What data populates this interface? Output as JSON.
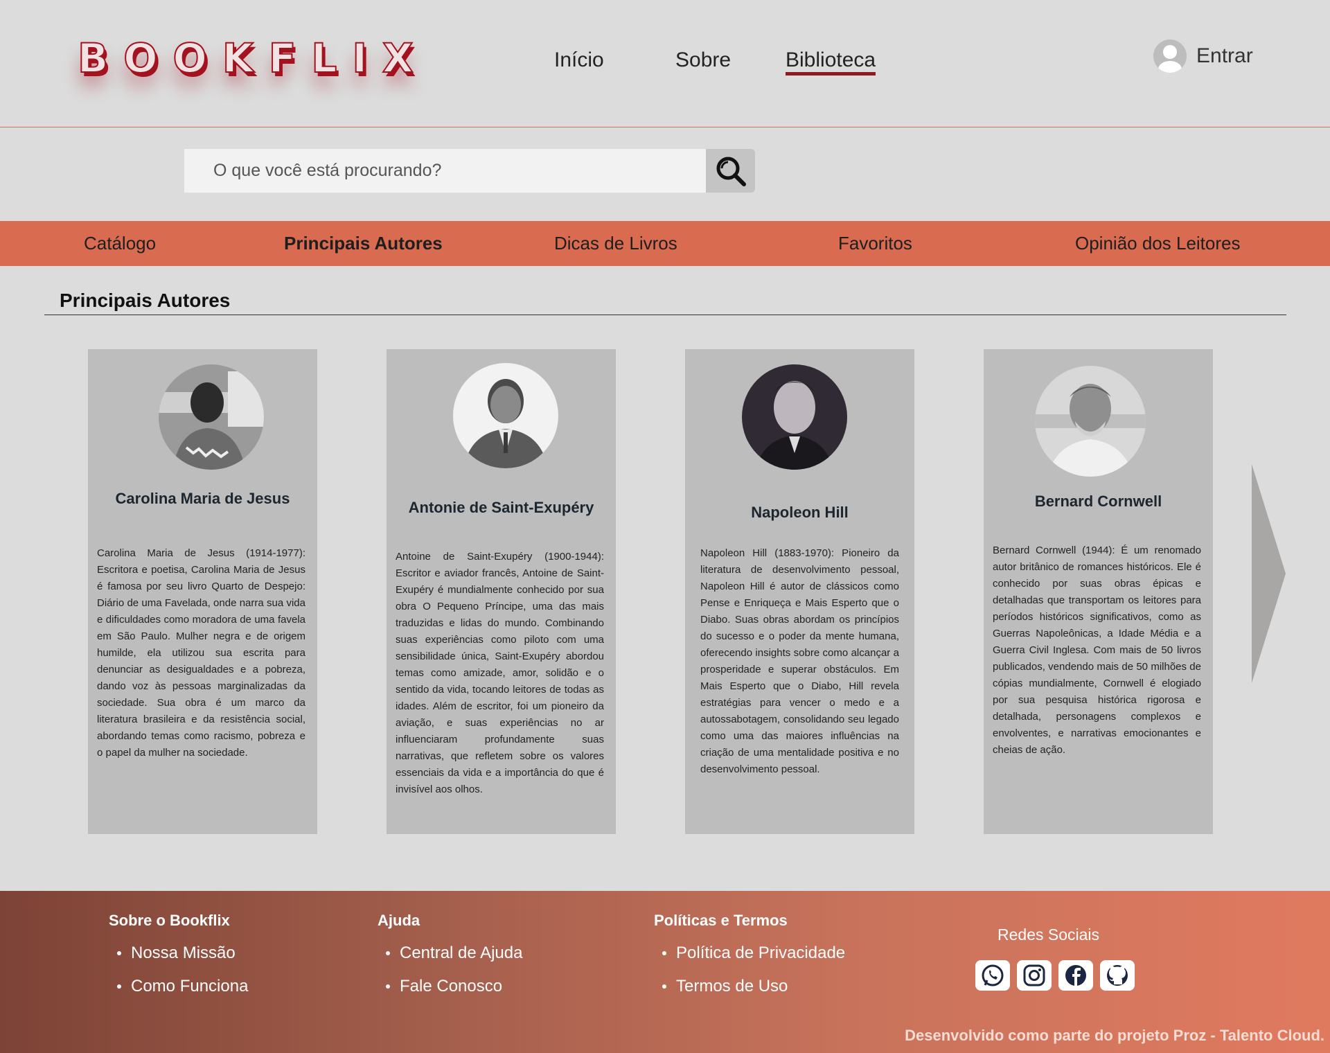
{
  "header": {
    "logo": "BOOKFLIX",
    "nav": [
      "Início",
      "Sobre",
      "Biblioteca"
    ],
    "active_nav": "Biblioteca",
    "login_label": "Entrar"
  },
  "search": {
    "placeholder": "O que você está procurando?"
  },
  "categories": [
    "Catálogo",
    "Principais Autores",
    "Dicas de Livros",
    "Favoritos",
    "Opinião dos Leitores"
  ],
  "active_category": "Principais Autores",
  "section": {
    "title": "Principais Autores"
  },
  "authors": [
    {
      "name": "Carolina Maria de Jesus",
      "bio": "Carolina Maria de Jesus (1914-1977): Escritora e poetisa, Carolina Maria de Jesus é famosa por seu livro Quarto de Despejo: Diário de uma Favelada, onde narra sua vida e dificuldades como moradora de uma favela em São Paulo. Mulher negra e de origem humilde, ela utilizou sua escrita para denunciar as desigualdades e a pobreza, dando voz às pessoas marginalizadas da sociedade. Sua obra é um marco da literatura brasileira e da resistência social, abordando temas como racismo, pobreza e o papel da mulher na sociedade."
    },
    {
      "name": "Antonie de Saint-Exupéry",
      "bio": "Antoine de Saint-Exupéry (1900-1944): Escritor e aviador francês, Antoine de Saint-Exupéry é mundialmente conhecido por sua obra O Pequeno Príncipe, uma das mais traduzidas e lidas do mundo. Combinando suas experiências como piloto com uma sensibilidade única, Saint-Exupéry abordou temas como amizade, amor, solidão e o sentido da vida, tocando leitores de todas as idades. Além de escritor, foi um pioneiro da aviação, e suas experiências no ar influenciaram profundamente suas narrativas, que refletem sobre os valores essenciais da vida e a importância do que é invisível aos olhos."
    },
    {
      "name": "Napoleon Hill",
      "bio": "Napoleon Hill (1883-1970): Pioneiro da literatura de desenvolvimento pessoal, Napoleon Hill é autor de clássicos como Pense e Enriqueça e Mais Esperto que o Diabo. Suas obras abordam os princípios do sucesso e o poder da mente humana, oferecendo insights sobre como alcançar a prosperidade e superar obstáculos. Em Mais Esperto que o Diabo, Hill revela estratégias para vencer o medo e a autossabotagem, consolidando seu legado como uma das maiores influências na criação de uma mentalidade positiva e no desenvolvimento pessoal."
    },
    {
      "name": "Bernard Cornwell",
      "bio": "Bernard Cornwell (1944): É um renomado autor britânico de romances históricos. Ele é conhecido por suas obras épicas e detalhadas que transportam os leitores para períodos históricos significativos, como as Guerras Napoleônicas, a Idade Média e a Guerra Civil Inglesa. Com mais de 50 livros publicados, vendendo mais de 50 milhões de cópias mundialmente, Cornwell é elogiado por sua pesquisa histórica rigorosa e detalhada, personagens complexos e envolventes, e narrativas emocionantes e cheias de ação."
    }
  ],
  "footer": {
    "columns": [
      {
        "title": "Sobre o Bookflix",
        "links": [
          "Nossa Missão",
          "Como Funciona"
        ]
      },
      {
        "title": "Ajuda",
        "links": [
          "Central de Ajuda",
          "Fale Conosco"
        ]
      },
      {
        "title": "Políticas e Termos",
        "links": [
          "Política de Privacidade",
          "Termos de Uso"
        ]
      }
    ],
    "social_title": "Redes Sociais",
    "social_icons": [
      "whatsapp-icon",
      "instagram-icon",
      "facebook-icon",
      "github-icon"
    ],
    "credit": "Desenvolvido como parte do projeto Proz - Talento Cloud."
  },
  "colors": {
    "brand": "#a3131f",
    "category_bar": "#d96b50",
    "card": "#bdbdbd",
    "footer_start": "#7d4336",
    "footer_end": "#e07a5f"
  }
}
